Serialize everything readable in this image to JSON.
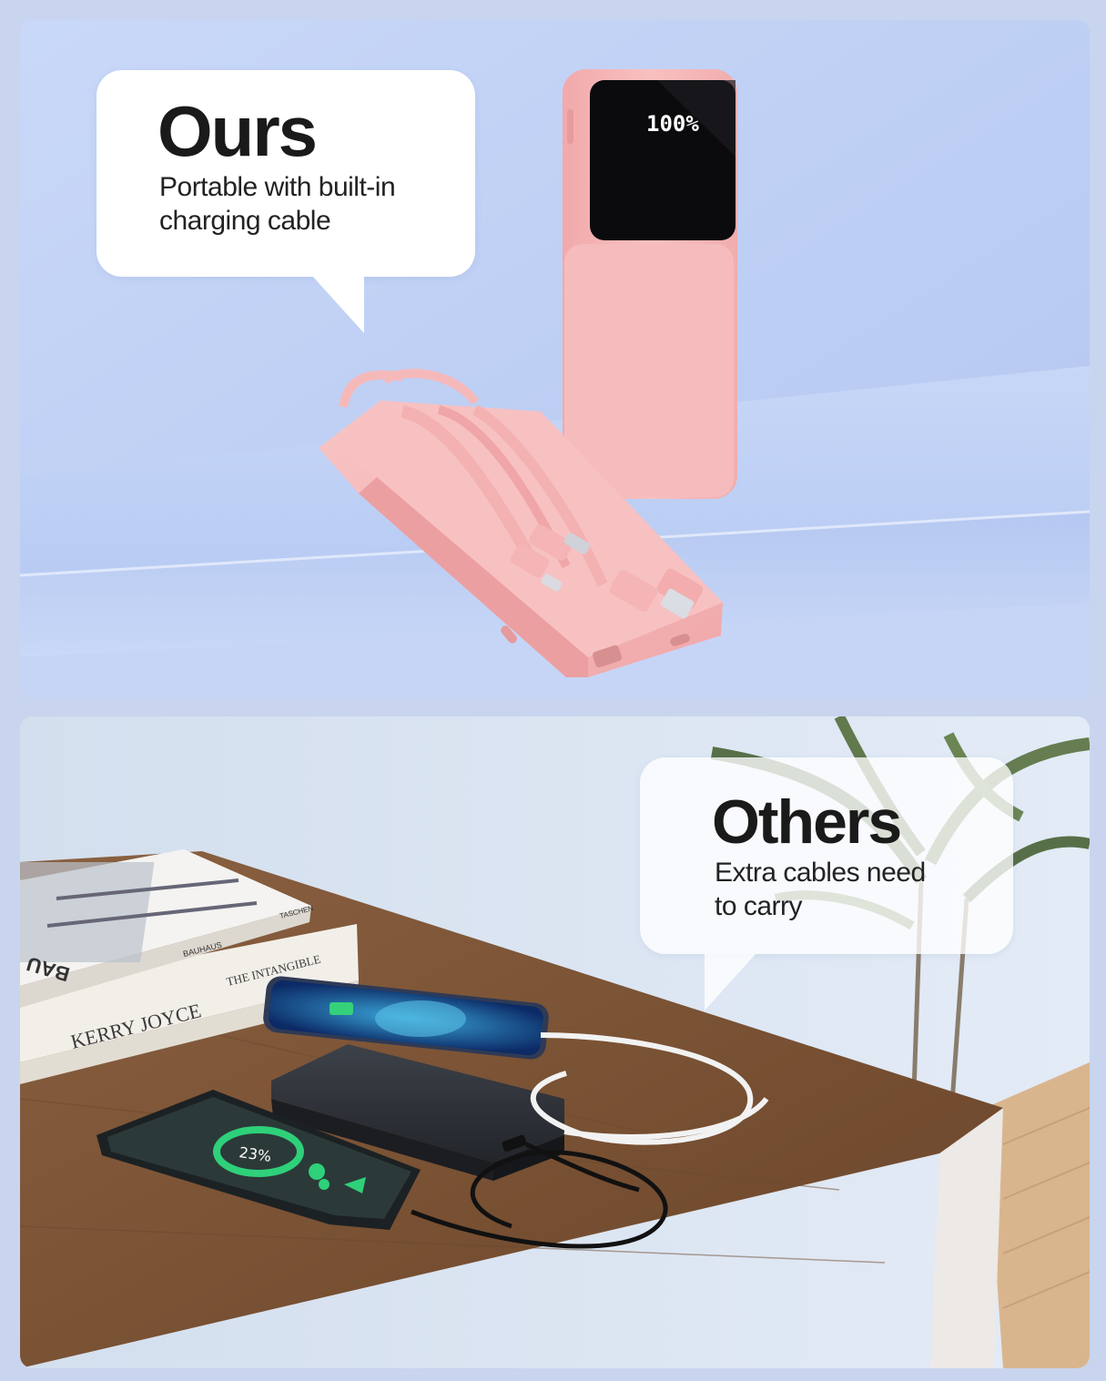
{
  "ours": {
    "title": "Ours",
    "subtitle_line1": "Portable with built-in",
    "subtitle_line2": "charging cable",
    "display_reading": "100%"
  },
  "others": {
    "title": "Others",
    "subtitle_line1": "Extra cables need",
    "subtitle_line2": "to carry",
    "phone_reading": "23%"
  },
  "books": {
    "book1_spine": "KERRY JOYCE",
    "book1_title": "THE INTANGIBLE",
    "book2_title": "BAUHAUS",
    "book2_publisher": "TASCHEN",
    "book2_spine": "BAU"
  },
  "colors": {
    "background": "#c9d5ee",
    "top_wall": "#c3d3f6",
    "powerbank_pink": "#f5b8b8",
    "desk_wood": "#7b5537",
    "black_powerbank": "#2d3036"
  },
  "icons": {
    "ours_tail": "speech-bubble-tail",
    "others_tail": "speech-bubble-tail"
  }
}
